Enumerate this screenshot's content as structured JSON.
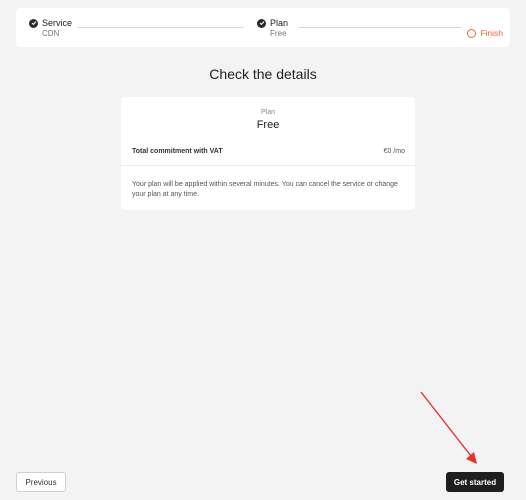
{
  "stepper": {
    "steps": [
      {
        "title": "Service",
        "value": "CDN",
        "status": "done"
      },
      {
        "title": "Plan",
        "value": "Free",
        "status": "done"
      }
    ],
    "finish_label": "Finish"
  },
  "main": {
    "heading": "Check the details",
    "card": {
      "plan_label": "Plan",
      "plan_value": "Free",
      "commitment_label": "Total commitment with VAT",
      "commitment_value": "€0 /mo",
      "note": "Your plan will be applied within several minutes. You can cancel the service or change your plan at any time."
    }
  },
  "footer": {
    "previous_label": "Previous",
    "get_started_label": "Get started"
  },
  "colors": {
    "accent": "#e8643a",
    "annotation_arrow": "#e8312a",
    "primary_button": "#1e1e1e"
  }
}
